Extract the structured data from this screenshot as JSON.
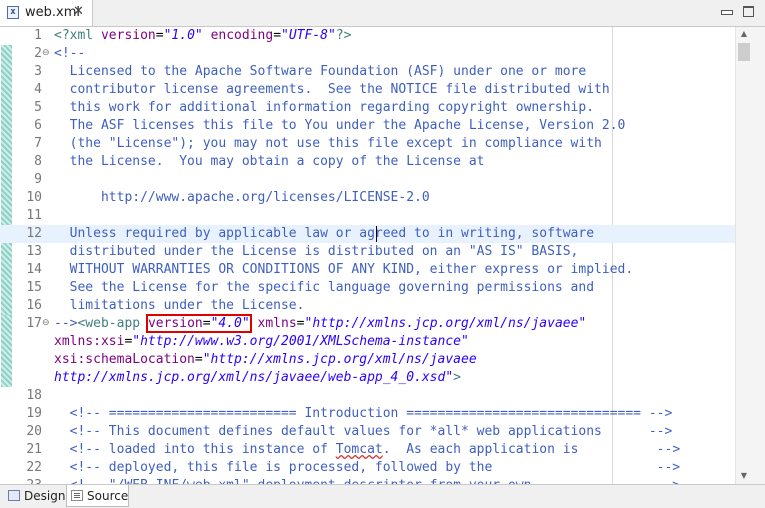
{
  "tab": {
    "icon": "xml-file-icon",
    "title": "web.xml",
    "close": "✕"
  },
  "window": {
    "minimize_icon": "minimize-icon",
    "maximize_icon": "maximize-icon"
  },
  "editor": {
    "lines": [
      {
        "num": "1",
        "fold": "",
        "tokens": [
          {
            "t": "<?xml ",
            "c": "tag"
          },
          {
            "t": "version",
            "c": "attr"
          },
          {
            "t": "=",
            "c": "plain"
          },
          {
            "t": "\"1.0\"",
            "c": "val"
          },
          {
            "t": " ",
            "c": "plain"
          },
          {
            "t": "encoding",
            "c": "attr"
          },
          {
            "t": "=",
            "c": "plain"
          },
          {
            "t": "\"UTF-8\"",
            "c": "val"
          },
          {
            "t": "?>",
            "c": "tag"
          }
        ]
      },
      {
        "num": "2",
        "fold": "⊖",
        "tokens": [
          {
            "t": "<!--",
            "c": "comment"
          }
        ]
      },
      {
        "num": "3",
        "fold": "",
        "tokens": [
          {
            "t": "  Licensed to the Apache Software Foundation (ASF) under one or more",
            "c": "comment"
          }
        ]
      },
      {
        "num": "4",
        "fold": "",
        "tokens": [
          {
            "t": "  contributor license agreements.  See the NOTICE file distributed with",
            "c": "comment"
          }
        ]
      },
      {
        "num": "5",
        "fold": "",
        "tokens": [
          {
            "t": "  this work for additional information regarding copyright ownership.",
            "c": "comment"
          }
        ]
      },
      {
        "num": "6",
        "fold": "",
        "tokens": [
          {
            "t": "  The ASF licenses this file to You under the Apache License, Version 2.0",
            "c": "comment"
          }
        ]
      },
      {
        "num": "7",
        "fold": "",
        "tokens": [
          {
            "t": "  (the \"License\"); you may not use this file except in compliance with",
            "c": "comment"
          }
        ]
      },
      {
        "num": "8",
        "fold": "",
        "tokens": [
          {
            "t": "  the License.  You may obtain a copy of the License at",
            "c": "comment"
          }
        ]
      },
      {
        "num": "9",
        "fold": "",
        "tokens": []
      },
      {
        "num": "10",
        "fold": "",
        "tokens": [
          {
            "t": "      http://www.apache.org/licenses/LICENSE-2.0",
            "c": "comment"
          }
        ]
      },
      {
        "num": "11",
        "fold": "",
        "tokens": []
      },
      {
        "num": "12",
        "fold": "",
        "current": true,
        "tokens": [
          {
            "t": "  Unless required by applicable law or agreed to in writing, software",
            "c": "comment"
          }
        ]
      },
      {
        "num": "13",
        "fold": "",
        "tokens": [
          {
            "t": "  distributed under the License is distributed on an \"AS IS\" BASIS,",
            "c": "comment"
          }
        ]
      },
      {
        "num": "14",
        "fold": "",
        "tokens": [
          {
            "t": "  WITHOUT WARRANTIES OR CONDITIONS OF ANY KIND, either express or implied.",
            "c": "comment"
          }
        ]
      },
      {
        "num": "15",
        "fold": "",
        "tokens": [
          {
            "t": "  See the License for the specific language governing permissions and",
            "c": "comment"
          }
        ]
      },
      {
        "num": "16",
        "fold": "",
        "tokens": [
          {
            "t": "  limitations under the License.",
            "c": "comment"
          }
        ]
      },
      {
        "num": "17",
        "fold": "⊖",
        "tokens": [
          {
            "t": "-->",
            "c": "comment"
          },
          {
            "t": "<web-app ",
            "c": "tag"
          },
          {
            "t": "version",
            "c": "attr",
            "hl": true
          },
          {
            "t": "=",
            "c": "plain",
            "hl": true
          },
          {
            "t": "\"4.0\"",
            "c": "val",
            "hl": true
          },
          {
            "t": " ",
            "c": "plain"
          },
          {
            "t": "xmlns",
            "c": "attr"
          },
          {
            "t": "=",
            "c": "plain"
          },
          {
            "t": "\"http://xmlns.jcp.org/xml/ns/javaee\"",
            "c": "val"
          }
        ]
      },
      {
        "num": "",
        "fold": "",
        "tokens": [
          {
            "t": "xmlns:xsi",
            "c": "attr"
          },
          {
            "t": "=",
            "c": "plain"
          },
          {
            "t": "\"http://www.w3.org/2001/XMLSchema-instance\"",
            "c": "val"
          }
        ]
      },
      {
        "num": "",
        "fold": "",
        "tokens": [
          {
            "t": "xsi:schemaLocation",
            "c": "attr"
          },
          {
            "t": "=",
            "c": "plain"
          },
          {
            "t": "\"http://xmlns.jcp.org/xml/ns/javaee",
            "c": "val"
          }
        ]
      },
      {
        "num": "",
        "fold": "",
        "tokens": [
          {
            "t": "http://xmlns.jcp.org/xml/ns/javaee/web-app_4_0.xsd\"",
            "c": "val"
          },
          {
            "t": ">",
            "c": "tag"
          }
        ]
      },
      {
        "num": "18",
        "fold": "",
        "tokens": []
      },
      {
        "num": "19",
        "fold": "",
        "tokens": [
          {
            "t": "  <!-- ======================== Introduction ============================== -->",
            "c": "comment"
          }
        ]
      },
      {
        "num": "20",
        "fold": "",
        "tokens": [
          {
            "t": "  <!-- This document defines default values for *all* web applications      -->",
            "c": "comment"
          }
        ]
      },
      {
        "num": "21",
        "fold": "",
        "tokens": [
          {
            "t": "  <!-- loaded into this instance of ",
            "c": "comment"
          },
          {
            "t": "Tomcat",
            "c": "comment",
            "spell": true
          },
          {
            "t": ".  As each application is          -->",
            "c": "comment"
          }
        ]
      },
      {
        "num": "22",
        "fold": "",
        "tokens": [
          {
            "t": "  <!-- deployed, this file is processed, followed by the                     -->",
            "c": "comment"
          }
        ]
      },
      {
        "num": "23",
        "fold": "",
        "tokens": [
          {
            "t": "  <!-- \"/WEB-INF/web.xml\" deployment descriptor from your own                -->",
            "c": "comment"
          }
        ]
      }
    ]
  },
  "bottom_tabs": [
    {
      "label": "Design",
      "icon": "design-view-icon"
    },
    {
      "label": "Source",
      "icon": "source-view-icon",
      "active": true
    }
  ]
}
